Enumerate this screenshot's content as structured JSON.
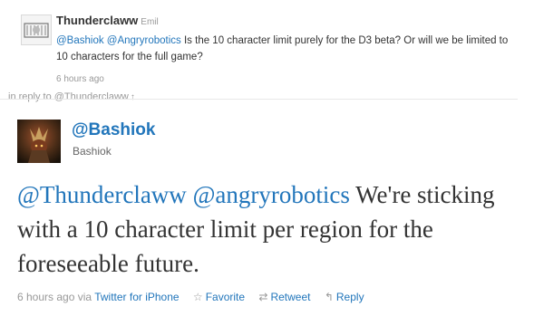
{
  "reply_tweet": {
    "username": "Thunderclaww",
    "real_name": "Emil",
    "mentions": [
      "@Bashiok",
      "@Angryrobotics"
    ],
    "text": "Is the 10 character limit purely for the D3 beta? Or will we be limited to 10 characters for the full game?",
    "timestamp": "6 hours ago"
  },
  "in_reply_to": {
    "label": "in reply to @Thunderclaww",
    "icon": "arrow-up-icon",
    "arrow_glyph": "↑"
  },
  "main_tweet": {
    "username": "@Bashiok",
    "real_name": "Bashiok",
    "mentions": [
      "@Thunderclaww",
      "@angryrobotics"
    ],
    "text": "We're sticking with a 10 character limit per region for the foreseeable future.",
    "timestamp": "6 hours ago",
    "via_label": "via",
    "source": "Twitter for iPhone"
  },
  "actions": [
    {
      "label": "Favorite",
      "icon": "star-icon",
      "glyph": "☆"
    },
    {
      "label": "Retweet",
      "icon": "retweet-icon",
      "glyph": "⇄"
    },
    {
      "label": "Reply",
      "icon": "reply-icon",
      "glyph": "↰"
    }
  ],
  "colors": {
    "link": "#2276bb",
    "text": "#333333",
    "muted": "#999999"
  }
}
